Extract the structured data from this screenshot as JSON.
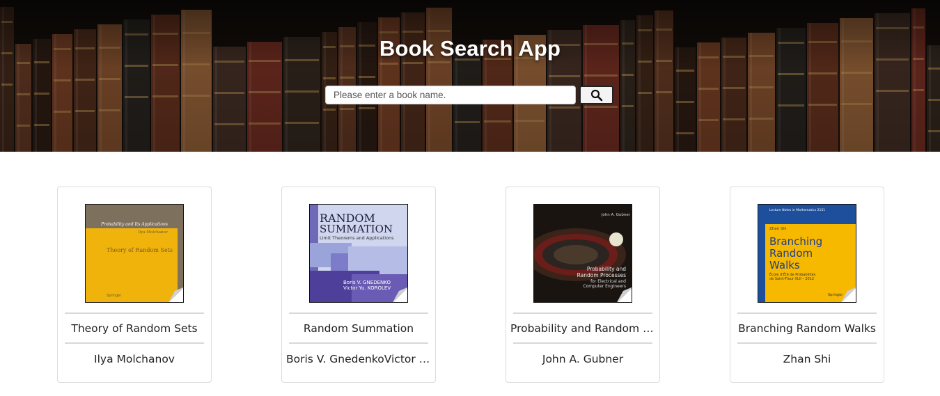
{
  "app": {
    "title": "Book Search App"
  },
  "search": {
    "placeholder": "Please enter a book name.",
    "value": "",
    "button_icon": "search-icon"
  },
  "books": [
    {
      "title": "Theory of Random Sets",
      "author": "Ilya Molchanov",
      "cover": {
        "series": "Probability and Its Applications",
        "author": "Ilya Molchanov",
        "title": "Theory of Random Sets",
        "publisher": "Springer",
        "color": "#f0b30c"
      }
    },
    {
      "title": "Random Summation",
      "author": "Boris V. GnedenkoVictor Y...",
      "cover": {
        "line1": "RANDOM",
        "line2": "SUMMATION",
        "subtitle": "Limit Theorems and Applications",
        "author1": "Boris V. GNEDENKO",
        "author2": "Victor Yu. KOROLEV",
        "color": "#5a4ea8"
      }
    },
    {
      "title": "Probability and Random P...",
      "author": "John A. Gubner",
      "cover": {
        "author": "John A. Gubner",
        "line1": "Probability and",
        "line2": "Random Processes",
        "line3": "for Electrical and",
        "line4": "Computer Engineers",
        "color": "#1a1410"
      }
    },
    {
      "title": "Branching Random Walks",
      "author": "Zhan Shi",
      "cover": {
        "series": "Lecture Notes in Mathematics 2151",
        "author": "Zhan Shi",
        "line1": "Branching",
        "line2": "Random",
        "line3": "Walks",
        "subtitle1": "École d'Été de Probabilités",
        "subtitle2": "de Saint-Flour XLII – 2012",
        "publisher": "Springer",
        "color": "#f7b800"
      }
    }
  ]
}
